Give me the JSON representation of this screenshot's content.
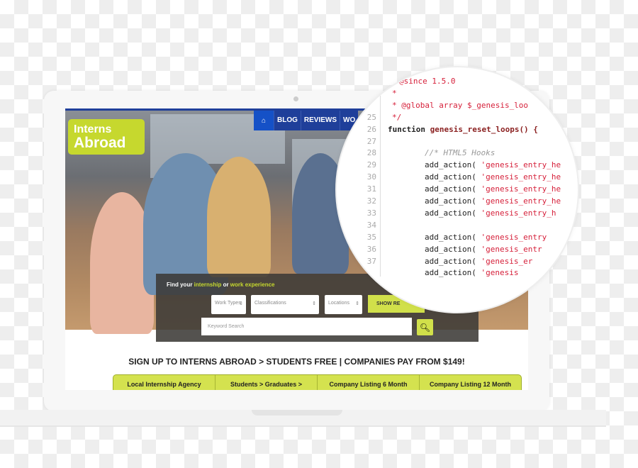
{
  "site": {
    "logo": {
      "line1": "Interns",
      "line2": "Abroad"
    },
    "nav": [
      "BLOG",
      "REVIEWS",
      "WO"
    ],
    "search": {
      "title_pre": "Find your ",
      "title_hl1": "internship",
      "title_mid": " or ",
      "title_hl2": "work experience",
      "work_types": "Work Types",
      "classifications": "Classifications",
      "locations": "Locations",
      "show_button": "SHOW RE",
      "keyword_placeholder": "Keyword Search"
    },
    "signup": "SIGN UP TO INTERNS ABROAD > STUDENTS FREE | COMPANIES PAY FROM $149!",
    "plans": [
      "Local Internship Agency",
      "Students > Graduates >",
      "Company Listing 6 Month",
      "Company Listing 12 Month"
    ]
  },
  "colors": {
    "accent": "#c6d82e",
    "nav": "#1f3f9a",
    "code_string": "#d6213b"
  },
  "code": {
    "lines": [
      {
        "n": "",
        "t": "@since 1.5.0",
        "c": "red"
      },
      {
        "n": "",
        "t": "*",
        "c": "red"
      },
      {
        "n": "",
        "t": "* @global array $_genesis_loo",
        "c": "red"
      },
      {
        "n": "25",
        "t": "*/",
        "c": "red"
      },
      {
        "n": "26",
        "t": "function",
        "fn": "genesis_reset_loops() {"
      },
      {
        "n": "27",
        "t": ""
      },
      {
        "n": "28",
        "t": "//* HTML5 Hooks",
        "c": "cm",
        "i": true
      },
      {
        "n": "29",
        "t": "add_action( ",
        "s": "'genesis_entry_he",
        "i": true
      },
      {
        "n": "30",
        "t": "add_action( ",
        "s": "'genesis_entry_he",
        "i": true
      },
      {
        "n": "31",
        "t": "add_action( ",
        "s": "'genesis_entry_he",
        "i": true
      },
      {
        "n": "32",
        "t": "add_action( ",
        "s": "'genesis_entry_he",
        "i": true
      },
      {
        "n": "33",
        "t": "add_action( ",
        "s": "'genesis_entry_h",
        "i": true
      },
      {
        "n": "34",
        "t": ""
      },
      {
        "n": "35",
        "t": "add_action( ",
        "s": "'genesis_entry",
        "i": true
      },
      {
        "n": "36",
        "t": "add_action( ",
        "s": "'genesis_entr",
        "i": true
      },
      {
        "n": "37",
        "t": "add_action( ",
        "s": "'genesis_er",
        "i": true
      },
      {
        "n": "",
        "t": "add_action( ",
        "s": "'genesis",
        "i": true
      }
    ]
  }
}
